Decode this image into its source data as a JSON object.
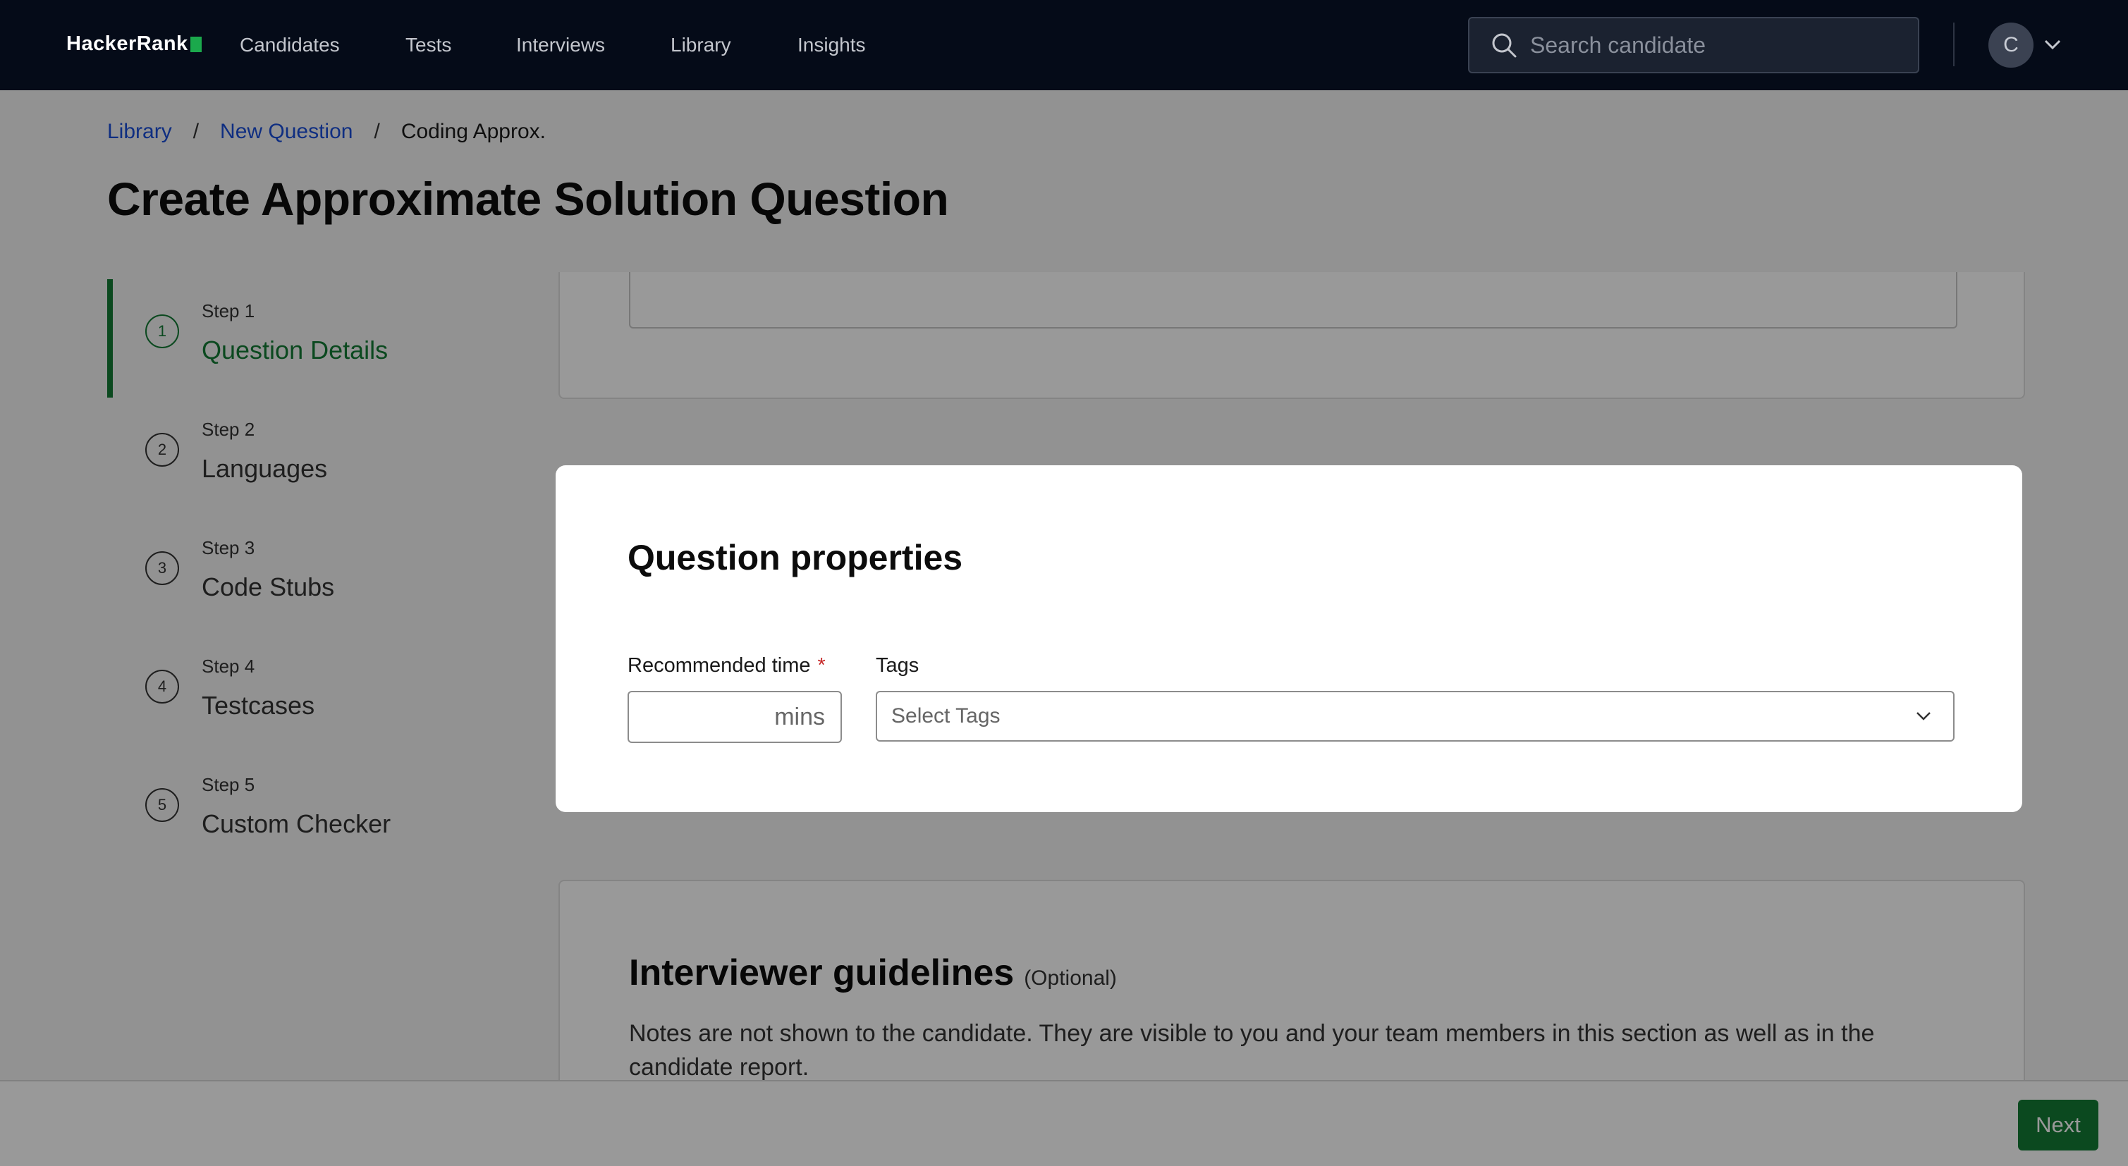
{
  "header": {
    "logo_text": "HackerRank",
    "nav_items": [
      {
        "label": "Candidates"
      },
      {
        "label": "Tests"
      },
      {
        "label": "Interviews"
      },
      {
        "label": "Library"
      },
      {
        "label": "Insights"
      }
    ],
    "search_placeholder": "Search candidate",
    "avatar_initial": "C"
  },
  "breadcrumb": {
    "items": [
      {
        "label": "Library"
      },
      {
        "label": "New Question"
      },
      {
        "label": "Coding Approx."
      }
    ],
    "separator": "/"
  },
  "page_title": "Create Approximate Solution Question",
  "steps": [
    {
      "step": "Step 1",
      "number": "1",
      "label": "Question Details",
      "active": true
    },
    {
      "step": "Step 2",
      "number": "2",
      "label": "Languages",
      "active": false
    },
    {
      "step": "Step 3",
      "number": "3",
      "label": "Code Stubs",
      "active": false
    },
    {
      "step": "Step 4",
      "number": "4",
      "label": "Testcases",
      "active": false
    },
    {
      "step": "Step 5",
      "number": "5",
      "label": "Custom Checker",
      "active": false
    }
  ],
  "modal": {
    "title": "Question properties",
    "recommended_time_label": "Recommended time",
    "required_marker": "*",
    "time_value": "",
    "time_suffix": "mins",
    "tags_label": "Tags",
    "tags_placeholder": "Select Tags"
  },
  "guidelines": {
    "title": "Interviewer guidelines",
    "optional": "(Optional)",
    "text": "Notes are not shown to the candidate. They are visible to you and your team members in this section as well as in the candidate report."
  },
  "footer": {
    "next_label": "Next"
  },
  "colors": {
    "nav_bg": "#050b18",
    "accent_green": "#137a35",
    "link_blue": "#1a4ed8",
    "required_red": "#c62828"
  }
}
